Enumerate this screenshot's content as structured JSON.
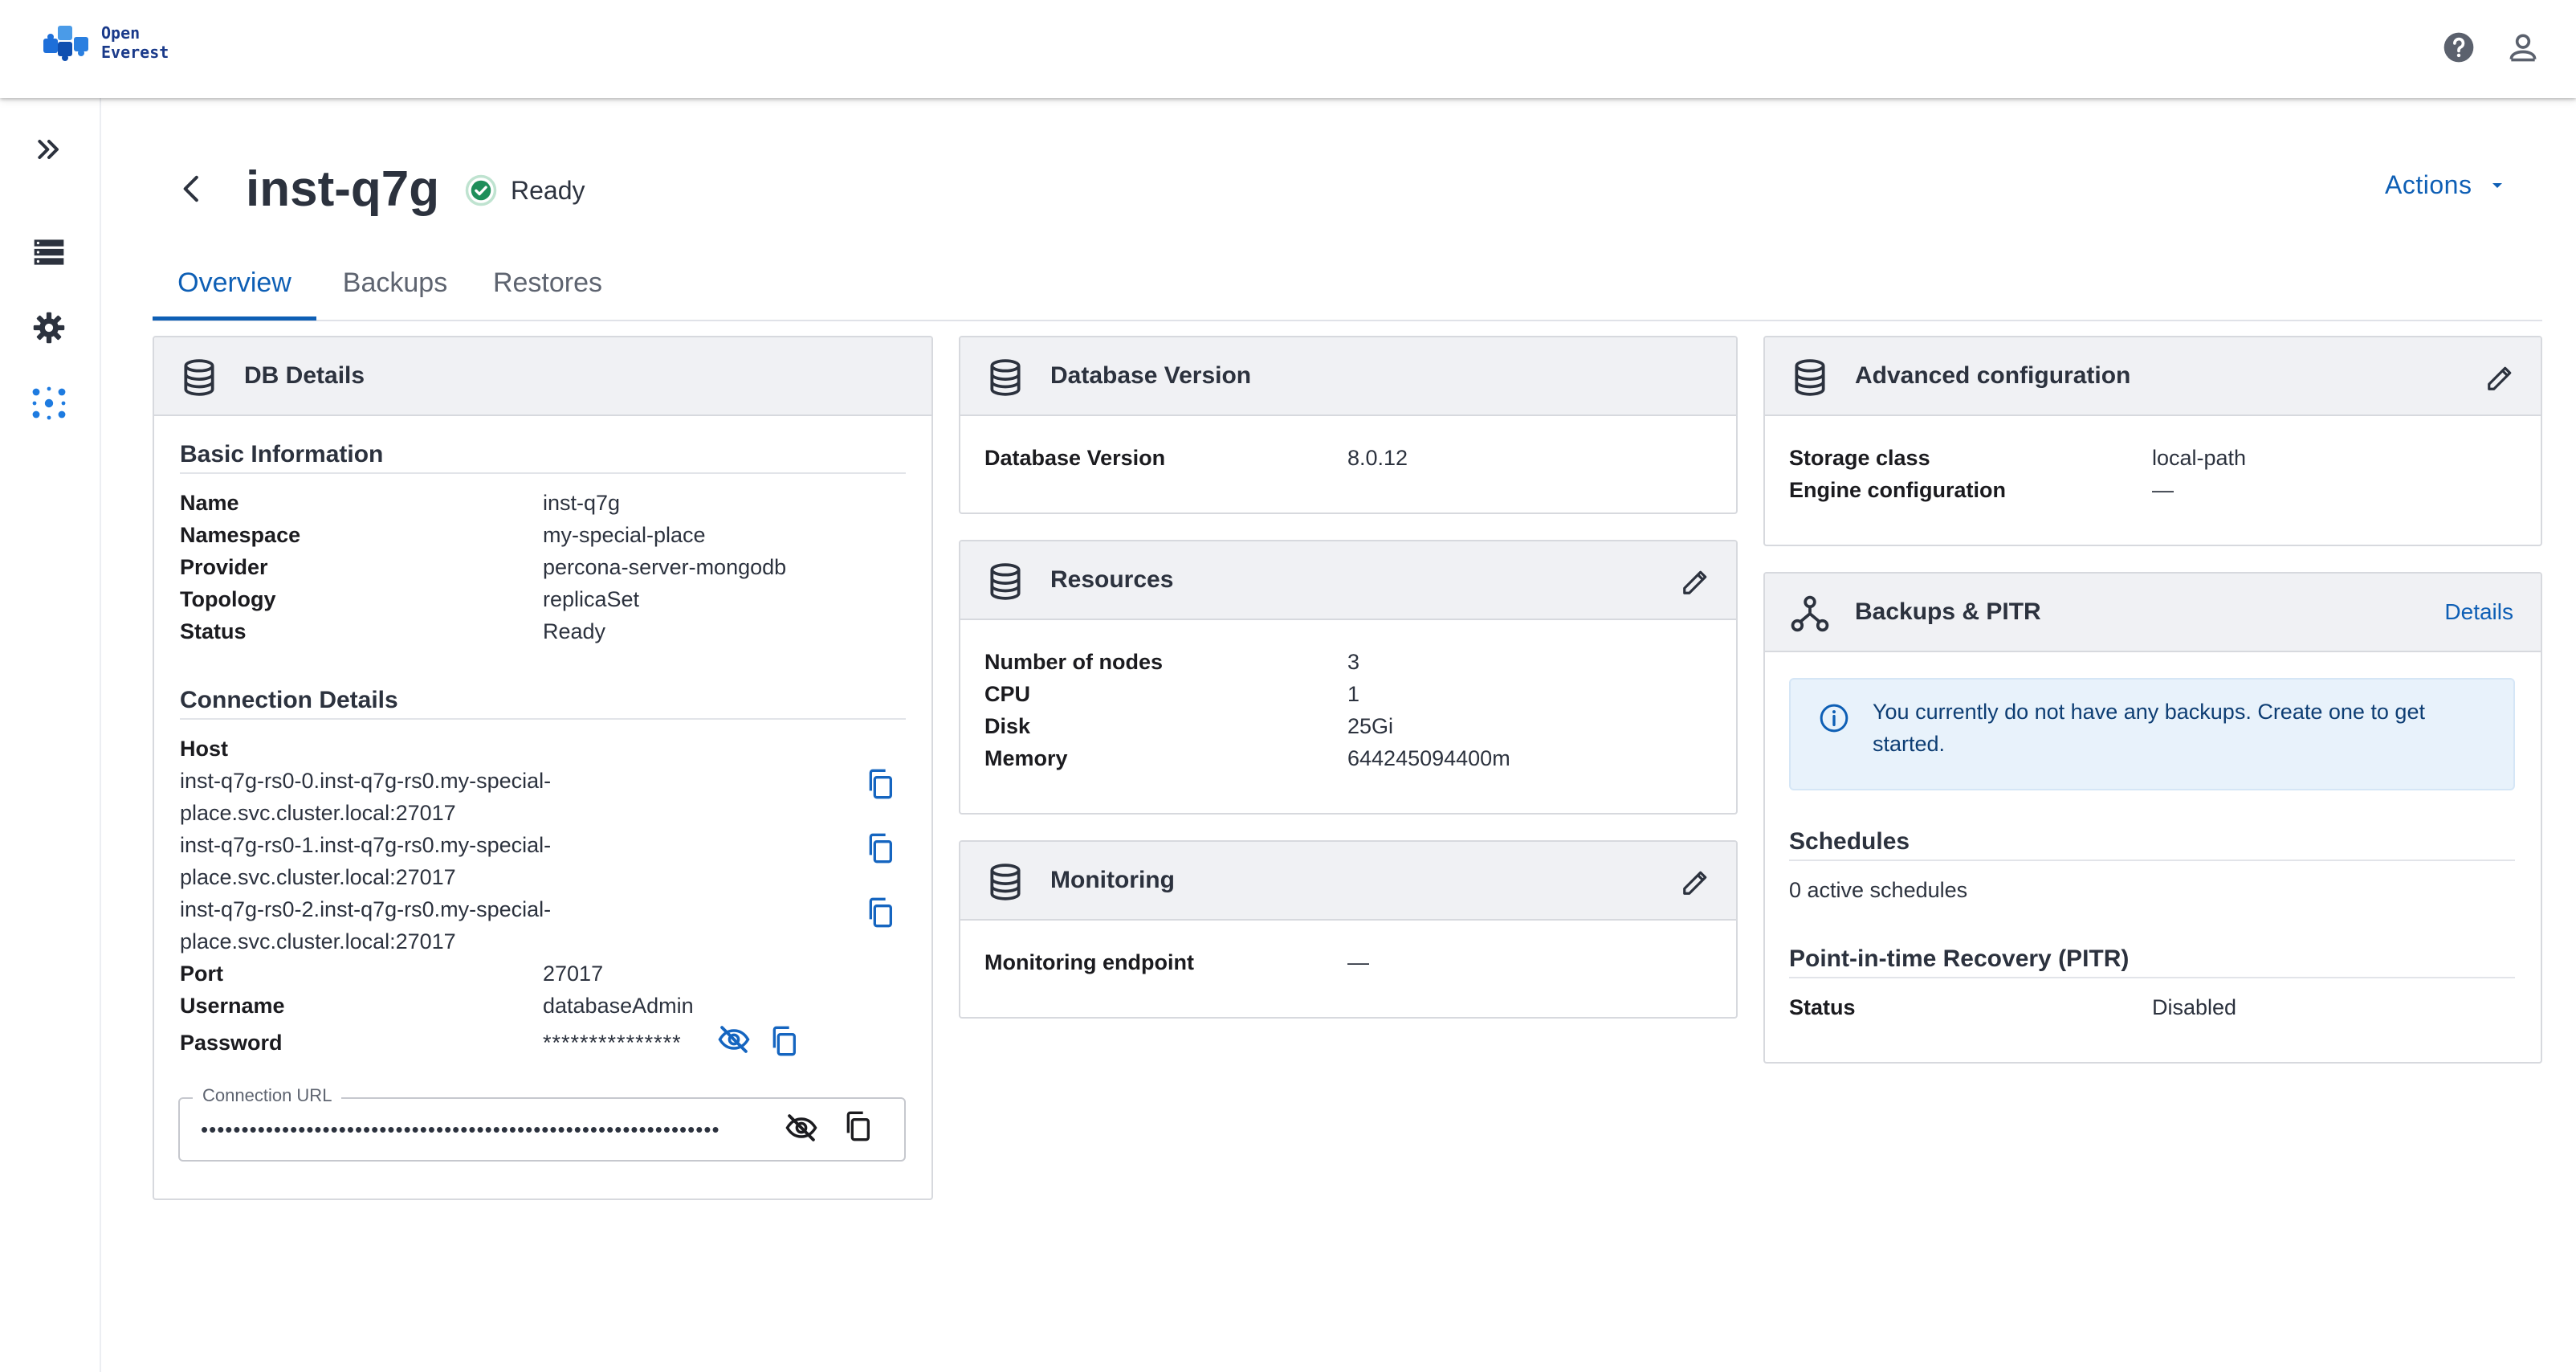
{
  "logo": {
    "line1": "Open",
    "line2": "Everest"
  },
  "topbar": {
    "help_icon": "help-circle-icon",
    "account_icon": "account-icon"
  },
  "sidebar": {
    "items": [
      {
        "icon": "double-chevron-right-icon"
      },
      {
        "icon": "database-list-icon"
      },
      {
        "icon": "gear-icon"
      },
      {
        "icon": "cluster-dots-icon",
        "active": true
      }
    ]
  },
  "header": {
    "title": "inst-q7g",
    "status": "Ready",
    "status_color": "#1e8e5a",
    "actions_label": "Actions"
  },
  "tabs": [
    {
      "label": "Overview",
      "active": true
    },
    {
      "label": "Backups"
    },
    {
      "label": "Restores"
    }
  ],
  "db_details": {
    "title": "DB Details",
    "basic_title": "Basic Information",
    "basic": [
      {
        "k": "Name",
        "v": "inst-q7g"
      },
      {
        "k": "Namespace",
        "v": "my-special-place"
      },
      {
        "k": "Provider",
        "v": "percona-server-mongodb"
      },
      {
        "k": "Topology",
        "v": "replicaSet"
      },
      {
        "k": "Status",
        "v": "Ready"
      }
    ],
    "conn_title": "Connection Details",
    "host_label": "Host",
    "hosts": [
      {
        "line1": "inst-q7g-rs0-0.inst-q7g-rs0.my-special-",
        "line2": "place.svc.cluster.local:27017"
      },
      {
        "line1": "inst-q7g-rs0-1.inst-q7g-rs0.my-special-",
        "line2": "place.svc.cluster.local:27017"
      },
      {
        "line1": "inst-q7g-rs0-2.inst-q7g-rs0.my-special-",
        "line2": "place.svc.cluster.local:27017"
      }
    ],
    "port_label": "Port",
    "port": "27017",
    "username_label": "Username",
    "username": "databaseAdmin",
    "password_label": "Password",
    "password_mask": "***************",
    "url_label": "Connection URL",
    "url_mask": "••••••••••••••••••••••••••••••••••••••••••••••••••••••••••••••••"
  },
  "db_version": {
    "title": "Database Version",
    "k": "Database Version",
    "v": "8.0.12"
  },
  "resources": {
    "title": "Resources",
    "rows": [
      {
        "k": "Number of nodes",
        "v": "3"
      },
      {
        "k": "CPU",
        "v": "1"
      },
      {
        "k": "Disk",
        "v": "25Gi"
      },
      {
        "k": "Memory",
        "v": "644245094400m"
      }
    ]
  },
  "monitoring": {
    "title": "Monitoring",
    "k": "Monitoring endpoint",
    "v": "—"
  },
  "advanced": {
    "title": "Advanced configuration",
    "rows": [
      {
        "k": "Storage class",
        "v": "local-path"
      },
      {
        "k": "Engine configuration",
        "v": "—"
      }
    ]
  },
  "backups": {
    "title": "Backups & PITR",
    "details_link": "Details",
    "alert": "You currently do not have any backups. Create one to get started.",
    "schedules_title": "Schedules",
    "schedules_text": "0 active schedules",
    "pitr_title": "Point-in-time Recovery (PITR)",
    "pitr_status_label": "Status",
    "pitr_status": "Disabled"
  }
}
